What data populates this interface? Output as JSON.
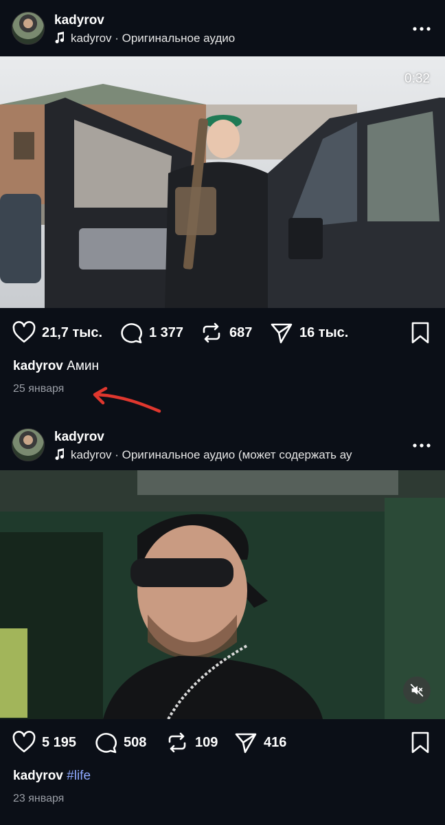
{
  "posts": [
    {
      "username": "kadyrov",
      "audio": "kadyrov · Оригинальное аудио",
      "duration": "0:32",
      "actions": {
        "likes": "21,7 тыс.",
        "comments": "1 377",
        "reposts": "687",
        "shares": "16 тыс."
      },
      "caption_user": "kadyrov",
      "caption_text": "Амин",
      "caption_hashtag": "",
      "date": "25 января"
    },
    {
      "username": "kadyrov",
      "audio": "kadyrov · Оригинальное аудио  (может содержать ау",
      "actions": {
        "likes": "5 195",
        "comments": "508",
        "reposts": "109",
        "shares": "416"
      },
      "caption_user": "kadyrov",
      "caption_text": "",
      "caption_hashtag": "#life",
      "date": "23 января"
    }
  ],
  "icons": {
    "note": "music-note-icon",
    "more": "more-dots-icon",
    "like": "heart-icon",
    "comment": "comment-bubble-icon",
    "repost": "repost-arrows-icon",
    "share": "send-paper-plane-icon",
    "bookmark": "bookmark-icon",
    "mute": "speaker-muted-icon"
  },
  "colors": {
    "background": "#0b0f17",
    "hashtag": "#8ea9ff",
    "annotation_arrow": "#e0372e",
    "date": "#9a9ea6"
  }
}
